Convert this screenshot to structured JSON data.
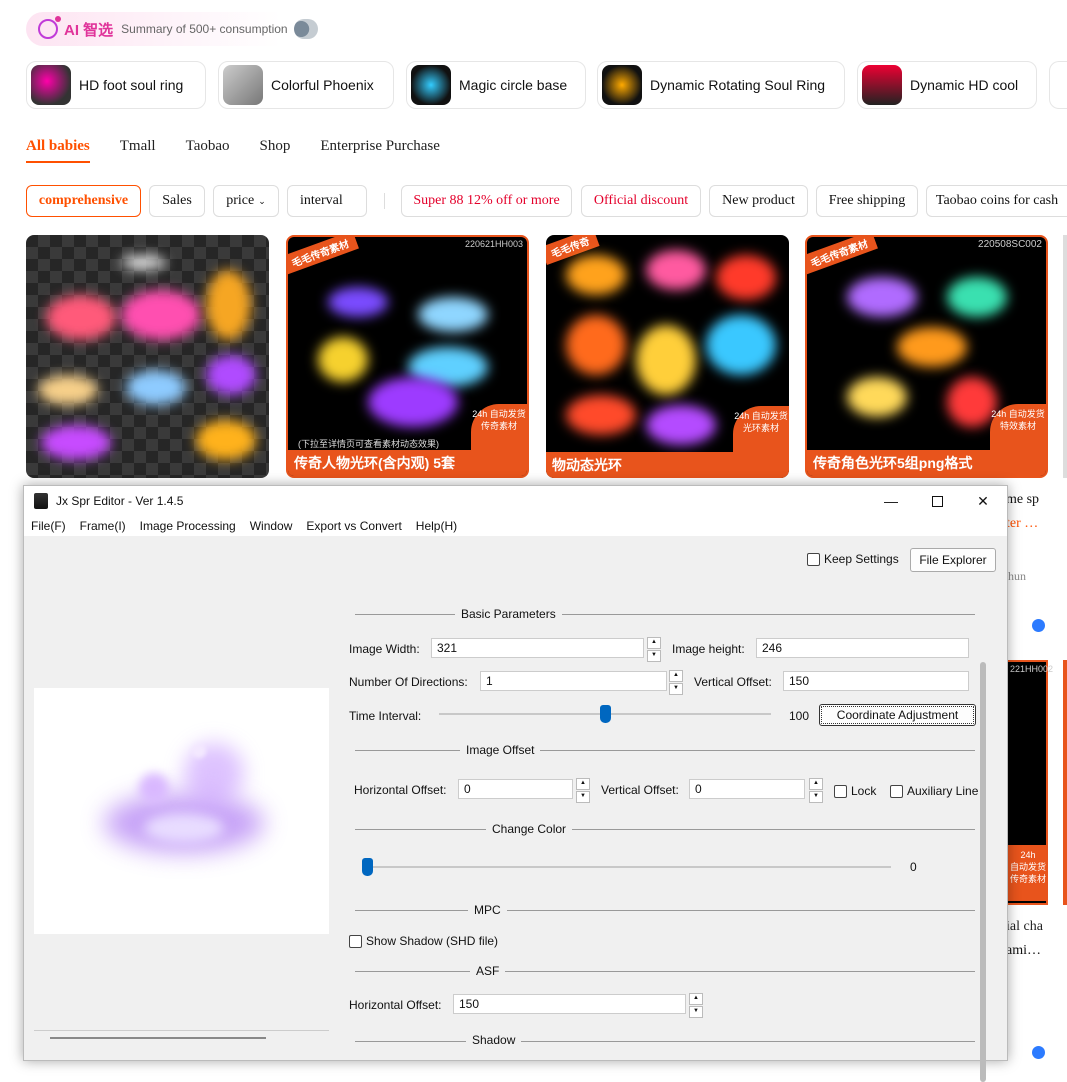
{
  "ai_bar": {
    "title": "AI 智选",
    "subtitle": "Summary of 500+ consumption"
  },
  "categories": [
    {
      "label": "HD foot soul ring"
    },
    {
      "label": "Colorful Phoenix"
    },
    {
      "label": "Magic circle base"
    },
    {
      "label": "Dynamic Rotating Soul Ring"
    },
    {
      "label": "Dynamic HD cool"
    }
  ],
  "tabs": [
    {
      "label": "All babies"
    },
    {
      "label": "Tmall"
    },
    {
      "label": "Taobao"
    },
    {
      "label": "Shop"
    },
    {
      "label": "Enterprise Purchase"
    }
  ],
  "filters": {
    "comprehensive": "comprehensive",
    "sales": "Sales",
    "price": "price",
    "interval": "interval",
    "super88": "Super 88 12% off or more",
    "official": "Official discount",
    "new_product": "New product",
    "free_shipping": "Free shipping",
    "coins": "Taobao coins for cash"
  },
  "products": [
    {
      "caption": ""
    },
    {
      "caption": "传奇人物光环(含内观) 5套",
      "code": "220621HH003",
      "tag": "毛毛传奇素材",
      "badge": "24h 自动发货 传奇素材",
      "note": "(下拉至详情页可查看素材动态效果)"
    },
    {
      "caption": "物动态光环",
      "tag": "毛毛传奇",
      "badge": "24h 自动发货 光环素材"
    },
    {
      "caption": "传奇角色光环5组png格式",
      "code": "220508SC002",
      "tag": "毛毛传奇素材",
      "badge": "24h 自动发货 特效素材"
    }
  ],
  "side_texts": {
    "a": "me sp",
    "b": "ter …",
    "c": "hun",
    "d": "221HH002",
    "e": "24h",
    "f": "自动发货",
    "g": "传奇素材",
    "h": "ial cha",
    "i": "ami…"
  },
  "editor": {
    "title": "Jx Spr Editor - Ver 1.4.5",
    "menu": [
      "File(F)",
      "Frame(I)",
      "Image Processing",
      "Window",
      "Export vs Convert",
      "Help(H)"
    ],
    "keep_settings": "Keep Settings",
    "file_explorer": "File Explorer",
    "basic_parameters": "Basic Parameters",
    "image_width_label": "Image Width:",
    "image_width": "321",
    "image_height_label": "Image height:",
    "image_height": "246",
    "directions_label": "Number Of Directions:",
    "directions": "1",
    "vertical_offset_label": "Vertical Offset:",
    "vertical_offset": "150",
    "time_interval_label": "Time Interval:",
    "time_interval": "100",
    "time_interval_fraction": 0.5,
    "coordinate_adjustment": "Coordinate Adjustment",
    "image_offset": "Image Offset",
    "h_offset_label": "Horizontal Offset:",
    "h_offset": "0",
    "v_offset_label": "Vertical Offset:",
    "v_offset": "0",
    "lock": "Lock",
    "auxiliary_line": "Auxiliary Line",
    "change_color": "Change Color",
    "color_value": "0",
    "mpc": "MPC",
    "show_shadow": "Show Shadow (SHD file)",
    "asf": "ASF",
    "asf_h_offset_label": "Horizontal Offset:",
    "asf_h_offset": "150",
    "shadow": "Shadow"
  },
  "colors": {
    "accent": "#ff5000",
    "brand_pink": "#e0339a",
    "slider": "#0067c0",
    "caption": "#e8541c"
  }
}
